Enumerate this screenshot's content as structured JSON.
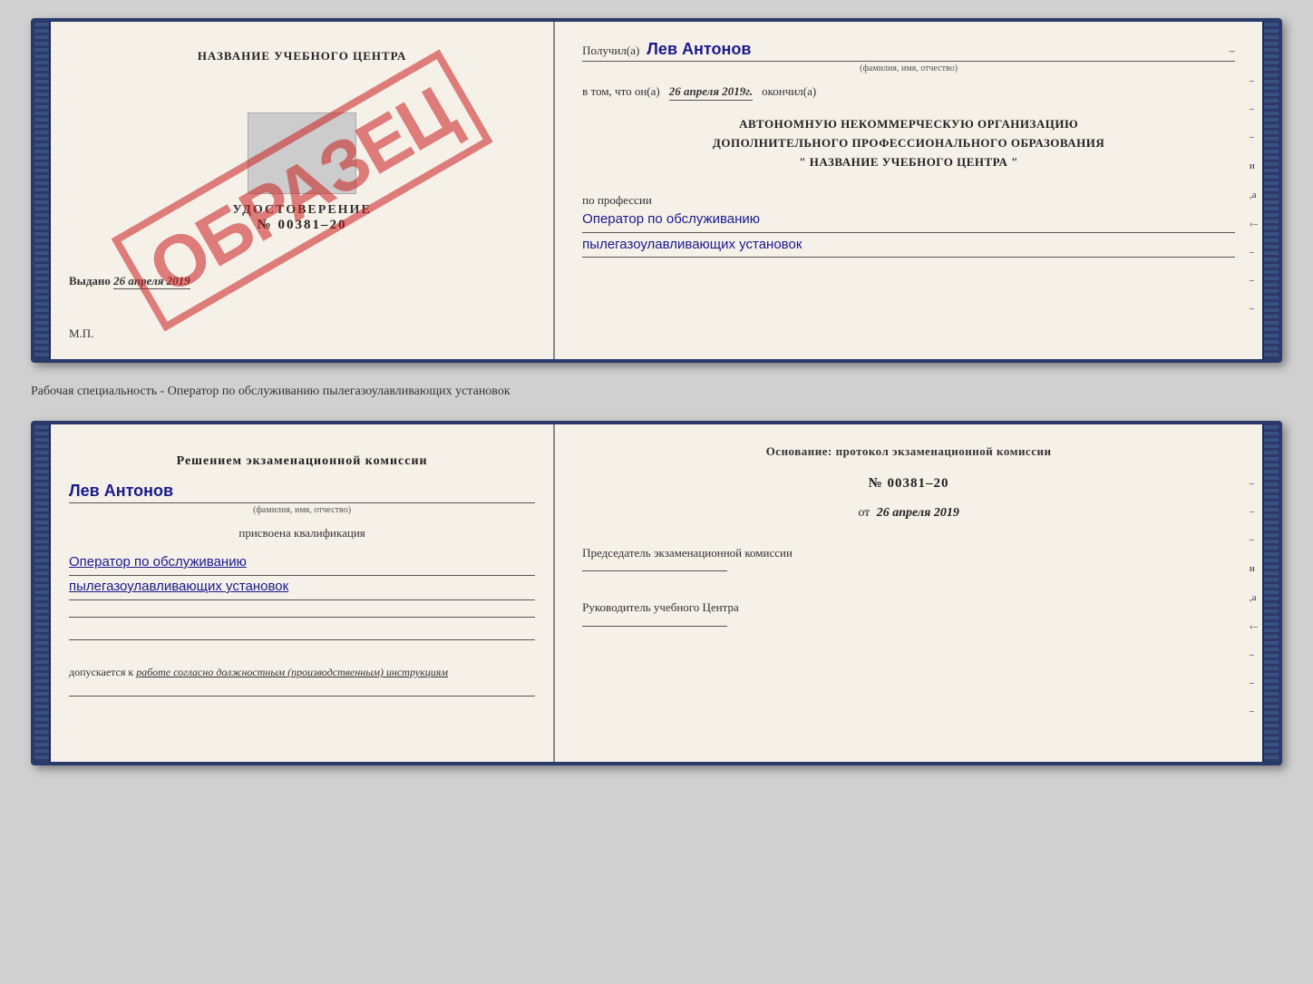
{
  "topCert": {
    "leftSide": {
      "schoolName": "НАЗВАНИЕ УЧЕБНОГО ЦЕНТРА",
      "certLabel": "УДОСТОВЕРЕНИЕ",
      "certNumber": "№ 00381–20",
      "issued": "Выдано",
      "issuedDate": "26 апреля 2019",
      "mp": "М.П.",
      "stamp": "ОБРАЗЕЦ"
    },
    "rightSide": {
      "receivedLabel": "Получил(а)",
      "recipientName": "Лев Антонов",
      "recipientSubtitle": "(фамилия, имя, отчество)",
      "inThatLabel": "в том, что он(а)",
      "completedDate": "26 апреля 2019г.",
      "completedLabel": "окончил(а)",
      "orgLine1": "АВТОНОМНУЮ НЕКОММЕРЧЕСКУЮ ОРГАНИЗАЦИЮ",
      "orgLine2": "ДОПОЛНИТЕЛЬНОГО ПРОФЕССИОНАЛЬНОГО ОБРАЗОВАНИЯ",
      "orgLine3": "\" НАЗВАНИЕ УЧЕБНОГО ЦЕНТРА \"",
      "professionLabel": "по профессии",
      "professionLine1": "Оператор по обслуживанию",
      "professionLine2": "пылегазоулавливающих установок"
    }
  },
  "separatorText": "Рабочая специальность - Оператор по обслуживанию пылегазоулавливающих установок",
  "bottomCert": {
    "leftSide": {
      "commissionText": "Решением экзаменационной комиссии",
      "personName": "Лев Антонов",
      "personSubtitle": "(фамилия, имя, отчество)",
      "qualificationLabel": "присвоена квалификация",
      "qualLine1": "Оператор по обслуживанию",
      "qualLine2": "пылегазоулавливающих установок",
      "допLabel": "допускается к",
      "допValue": "работе согласно должностным (производственным) инструкциям"
    },
    "rightSide": {
      "baseLabel": "Основание: протокол экзаменационной комиссии",
      "protocolNumber": "№ 00381–20",
      "protocolDatePrefix": "от",
      "protocolDate": "26 апреля 2019",
      "chairLabel": "Председатель экзаменационной комиссии",
      "headLabel": "Руководитель учебного Центра"
    }
  }
}
